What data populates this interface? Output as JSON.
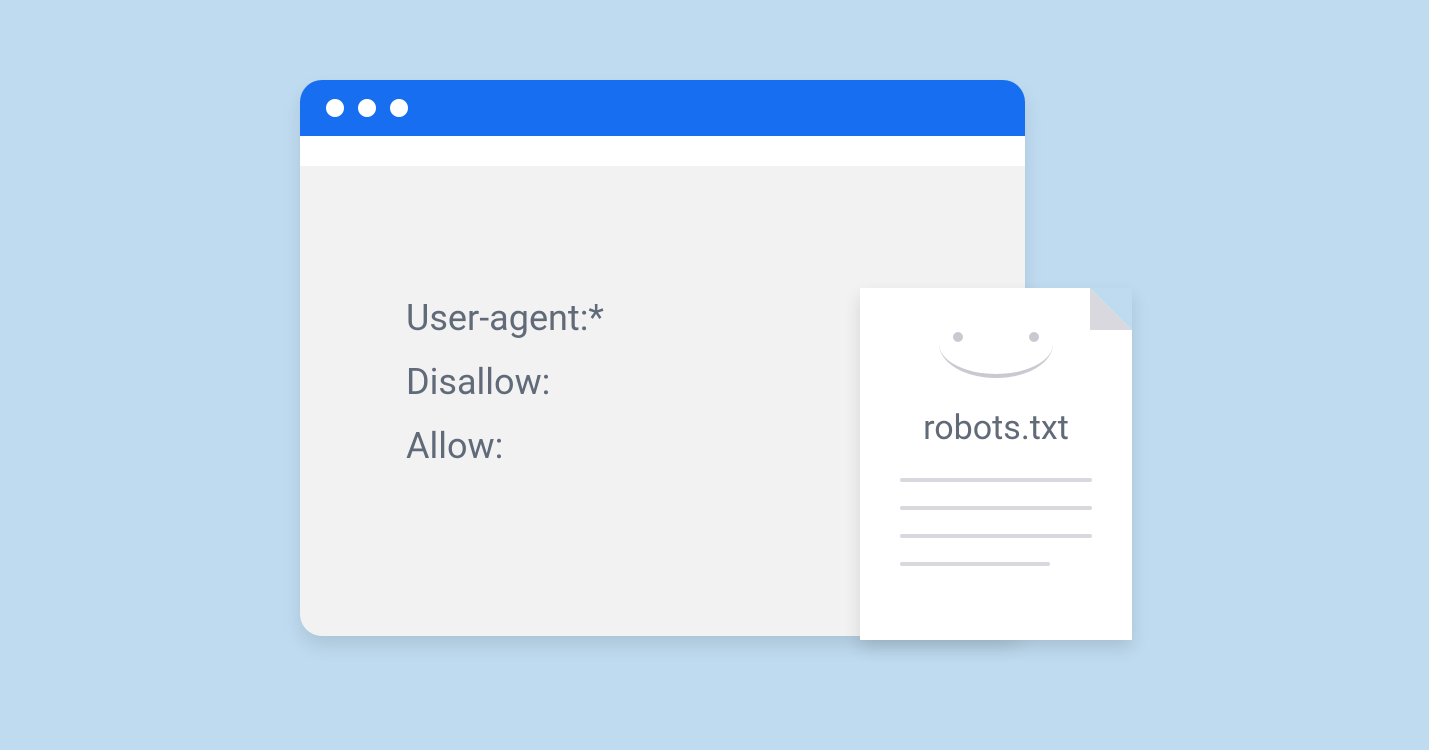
{
  "browser": {
    "content": {
      "line1": "User-agent:*",
      "line2": "Disallow:",
      "line3": "Allow:"
    }
  },
  "file": {
    "title": "robots.txt"
  }
}
